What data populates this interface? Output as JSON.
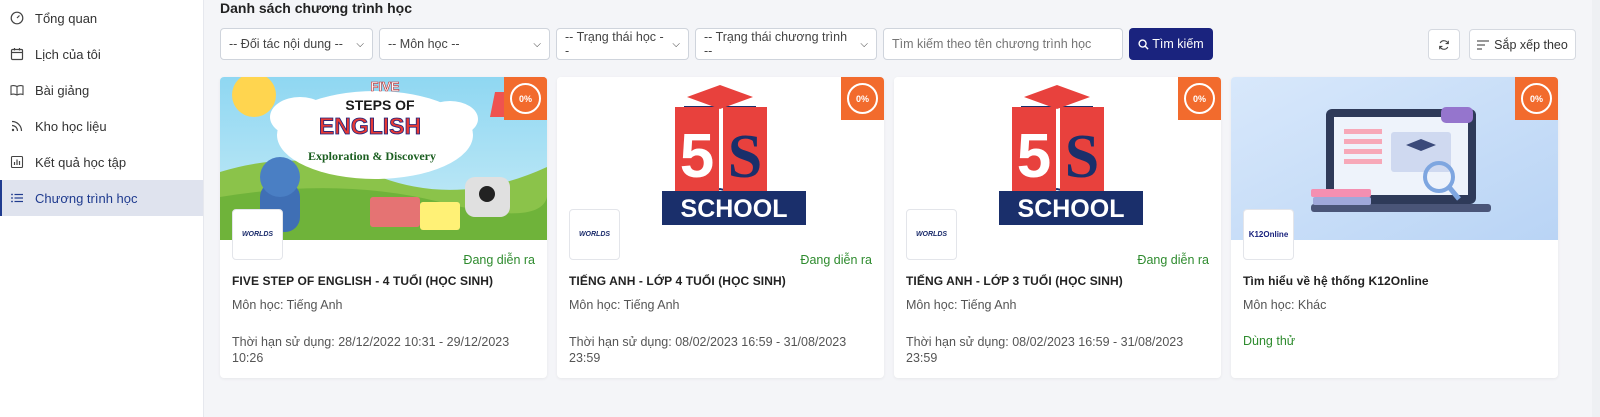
{
  "sidebar": {
    "items": [
      {
        "label": "Tổng quan",
        "icon": "dashboard-icon"
      },
      {
        "label": "Lịch của tôi",
        "icon": "calendar-icon"
      },
      {
        "label": "Bài giảng",
        "icon": "book-open-icon"
      },
      {
        "label": "Kho học liệu",
        "icon": "feed-icon"
      },
      {
        "label": "Kết quả học tập",
        "icon": "chart-icon"
      },
      {
        "label": "Chương trình học",
        "icon": "list-icon",
        "active": true
      }
    ]
  },
  "main": {
    "title": "Danh sách chương trình học",
    "filters": {
      "partner": "-- Đối tác nội dung --",
      "subject": "-- Môn học --",
      "study_status": "-- Trạng thái học --",
      "program_status": "-- Trạng thái chương trình --",
      "search_placeholder": "Tìm kiếm theo tên chương trình học",
      "search_button": "Tìm kiếm"
    },
    "sort_label": "Sắp xếp theo"
  },
  "cards": [
    {
      "title": "FIVE STEP OF ENGLISH - 4 TUỔI (HỌC SINH)",
      "subject": "Môn học: Tiếng Anh",
      "status": "Đang diễn ra",
      "duration": "Thời hạn sử dụng: 28/12/2022 10:31 - 29/12/2023 10:26",
      "progress": "0%",
      "image_text": {
        "line1": "FIVE",
        "line2": "STEPS OF",
        "line3": "ENGLISH",
        "line4": "Exploration & Discovery"
      },
      "partner": "WORLDS"
    },
    {
      "title": "TIẾNG ANH - LỚP 4 TUỔI (HỌC SINH)",
      "subject": "Môn học: Tiếng Anh",
      "status": "Đang diễn ra",
      "duration": "Thời hạn sử dụng: 08/02/2023 16:59 - 31/08/2023 23:59",
      "progress": "0%",
      "image_text": {
        "digit": "5",
        "letter": "S",
        "school": "SCHOOL"
      },
      "partner": "WORLDS"
    },
    {
      "title": "TIẾNG ANH - LỚP 3 TUỔI (HỌC SINH)",
      "subject": "Môn học: Tiếng Anh",
      "status": "Đang diễn ra",
      "duration": "Thời hạn sử dụng: 08/02/2023 16:59 - 31/08/2023 23:59",
      "progress": "0%",
      "image_text": {
        "digit": "5",
        "letter": "S",
        "school": "SCHOOL"
      },
      "partner": "WORLDS"
    },
    {
      "title": "Tìm hiểu về hệ thống K12Online",
      "subject": "Môn học: Khác",
      "trial": "Dùng thử",
      "progress": "0%",
      "partner": "K12Online"
    }
  ],
  "colors": {
    "primary": "#1a237e",
    "badge": "#f26b2d",
    "status_green": "#2e8b2e",
    "school_red": "#e8413d",
    "school_navy": "#1a2f6b"
  }
}
